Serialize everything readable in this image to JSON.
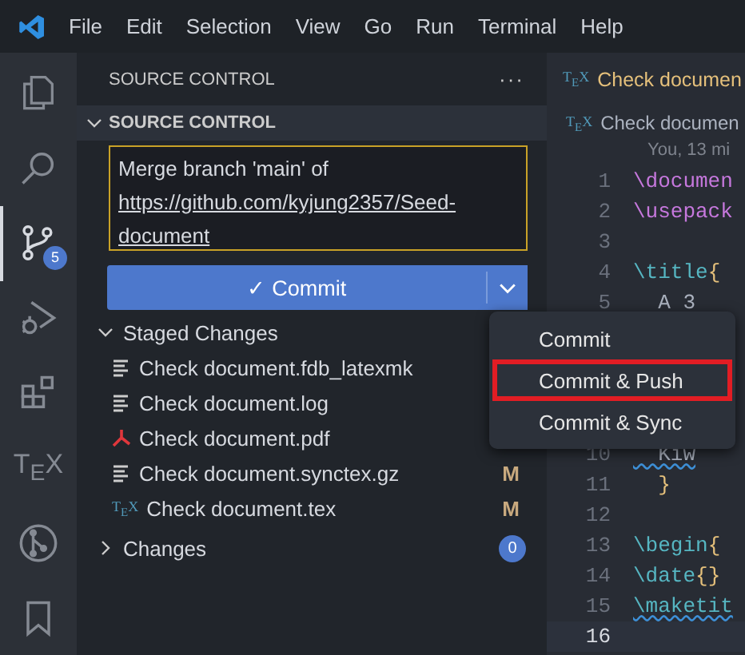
{
  "menu_bar": {
    "items": [
      "File",
      "Edit",
      "Selection",
      "View",
      "Go",
      "Run",
      "Terminal",
      "Help"
    ]
  },
  "activity_bar": [
    {
      "kind": "files",
      "selected": false
    },
    {
      "kind": "search",
      "selected": false
    },
    {
      "kind": "source-control",
      "selected": true,
      "badge": "5"
    },
    {
      "kind": "run",
      "selected": false
    },
    {
      "kind": "extensions",
      "selected": false
    },
    {
      "kind": "tex",
      "label": "T$_{E}$X",
      "selected": false
    },
    {
      "kind": "git-graph",
      "selected": false
    },
    {
      "kind": "bookmark",
      "selected": false
    }
  ],
  "sidebar": {
    "title": "SOURCE CONTROL",
    "more": "···",
    "section": {
      "title": "SOURCE CONTROL",
      "expanded": true
    },
    "message": {
      "line": "Merge branch 'main' of",
      "link": "https://github.com/kyjung2357/Seed-document"
    },
    "commit_button": {
      "label": "Commit",
      "check": "✓"
    },
    "groups": [
      {
        "title": "Staged Changes",
        "expanded": true,
        "files": [
          {
            "name": "Check document.fdb_latexmk",
            "kind": "text"
          },
          {
            "name": "Check document.log",
            "kind": "text"
          },
          {
            "name": "Check document.pdf",
            "kind": "pdf"
          },
          {
            "name": "Check document.synctex.gz",
            "kind": "text",
            "status": "M"
          },
          {
            "name": "Check document.tex",
            "kind": "tex",
            "icon_text": "T$_{E}$X",
            "status": "M"
          }
        ]
      },
      {
        "title": "Changes",
        "expanded": false,
        "count": "0"
      }
    ]
  },
  "editor": {
    "tab": {
      "icon_text": "T$_{E}$X",
      "label": "Check documen"
    },
    "breadcrumb": {
      "icon_text": "T$_{E}$X",
      "label": "Check documen"
    },
    "blame": "You, 13 mi",
    "lines": [
      {
        "num": "1",
        "current": false,
        "segs": [
          {
            "t": "\\documen",
            "kind": "cmd"
          }
        ]
      },
      {
        "num": "2",
        "current": false,
        "segs": [
          {
            "t": "\\usepack",
            "kind": "cmd"
          }
        ]
      },
      {
        "num": "3",
        "current": false
      },
      {
        "num": "4",
        "current": false,
        "segs": [
          {
            "t": "\\title",
            "kind": "cmd2"
          },
          {
            "t": "{",
            "kind": "brace"
          }
        ]
      },
      {
        "num": "5",
        "current": false,
        "segs": [
          {
            "t": "  A 3",
            "kind": "text"
          }
        ]
      },
      {
        "num": "10",
        "current": false,
        "segs": [
          {
            "t": "  Kiw",
            "kind": "squiggle"
          }
        ]
      },
      {
        "num": "11",
        "current": false,
        "segs": [
          {
            "t": "  }",
            "kind": "brace"
          }
        ]
      },
      {
        "num": "12",
        "current": false
      },
      {
        "num": "13",
        "current": false,
        "segs": [
          {
            "t": "\\begin",
            "kind": "cmd2"
          },
          {
            "t": "{",
            "kind": "brace"
          }
        ]
      },
      {
        "num": "14",
        "current": false,
        "segs": [
          {
            "t": "\\date",
            "kind": "cmd2"
          },
          {
            "t": "{}",
            "kind": "brace"
          }
        ]
      },
      {
        "num": "15",
        "current": false,
        "segs": [
          {
            "t": "\\maketit",
            "kind": "cmd2-squiggle"
          }
        ]
      },
      {
        "num": "16",
        "current": true
      }
    ]
  },
  "dropdown": [
    {
      "label": "Commit",
      "highlighted": false
    },
    {
      "label": "Commit & Push",
      "highlighted": true
    },
    {
      "label": "Commit & Sync",
      "highlighted": false
    }
  ]
}
